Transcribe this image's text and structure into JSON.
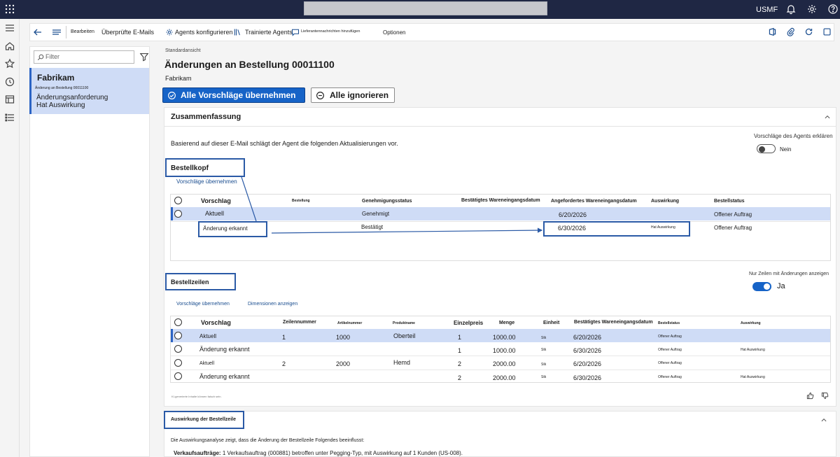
{
  "company": "USMF",
  "action_bar": {
    "edit": "Bearbeiten",
    "checked_emails": "Überprüfte E-Mails",
    "configure_agents": "Agents konfigurieren",
    "trained_agents": "Trainierte Agents",
    "add_vendor_messages": "Lieferantennachrichten hinzufügen",
    "options": "Optionen"
  },
  "list": {
    "filter_placeholder": "Filter",
    "item": {
      "title": "Fabrikam",
      "subtitle": "Änderung an Bestellung 00011100",
      "line1": "Änderungsanforderung",
      "line2": "Hat Auswirkung"
    }
  },
  "page": {
    "view": "Standardansicht",
    "title": "Änderungen an Bestellung 00011100",
    "vendor": "Fabrikam",
    "accept_all": "Alle Vorschläge übernehmen",
    "ignore_all": "Alle ignorieren"
  },
  "summary": {
    "title": "Zusammenfassung",
    "explain_label": "Vorschläge des Agents erklären",
    "explain_value": "Nein",
    "explain_on": false,
    "intro": "Basierend auf dieser E-Mail schlägt der Agent die folgenden Aktualisierungen vor."
  },
  "header_section": {
    "title": "Bestellkopf",
    "accept": "Vorschläge übernehmen",
    "columns": [
      "Vorschlag",
      "Bestellung",
      "Genehmigungsstatus",
      "Bestätigtes Wareneingangsdatum",
      "Angefordertes Wareneingangsdatum",
      "Auswirkung",
      "Bestellstatus"
    ],
    "rows": [
      {
        "proposal": "Aktuell",
        "order": "",
        "approval": "Genehmigt",
        "confirmed": "",
        "requested": "6/20/2026",
        "impact": "",
        "status": "Offener Auftrag"
      },
      {
        "proposal": "Änderung erkannt",
        "order": "",
        "approval": "Bestätigt",
        "confirmed": "",
        "requested": "6/30/2026",
        "impact": "Hat Auswirkung",
        "status": "Offener Auftrag"
      }
    ]
  },
  "lines_section": {
    "title": "Bestellzeilen",
    "only_changes_label": "Nur Zeilen mit Änderungen anzeigen",
    "only_changes_value": "Ja",
    "only_changes_on": true,
    "accept": "Vorschläge übernehmen",
    "dimensions": "Dimensionen anzeigen",
    "columns": [
      "Vorschlag",
      "Zeilennummer",
      "Artikelnummer",
      "Produktname",
      "Einzelpreis",
      "Menge",
      "Einheit",
      "Bestätigtes Wareneingangsdatum",
      "Bestellstatus",
      "Auswirkung"
    ],
    "rows": [
      {
        "proposal": "Aktuell",
        "line": "1",
        "item": "1000",
        "product": "Oberteil",
        "price": "1",
        "qty": "1000.00",
        "unit": "Stk",
        "date": "6/20/2026",
        "status": "Offener Auftrag",
        "impact": ""
      },
      {
        "proposal": "Änderung erkannt",
        "line": "",
        "item": "",
        "product": "",
        "price": "1",
        "qty": "1000.00",
        "unit": "Stk",
        "date": "6/30/2026",
        "status": "Offener Auftrag",
        "impact": "Hat Auswirkung"
      },
      {
        "proposal": "Aktuell",
        "line": "2",
        "item": "2000",
        "product": "Hemd",
        "price": "2",
        "qty": "2000.00",
        "unit": "Stk",
        "date": "6/20/2026",
        "status": "Offener Auftrag",
        "impact": ""
      },
      {
        "proposal": "Änderung erkannt",
        "line": "",
        "item": "",
        "product": "",
        "price": "2",
        "qty": "2000.00",
        "unit": "Stk",
        "date": "6/30/2026",
        "status": "Offener Auftrag",
        "impact": "Hat Auswirkung"
      }
    ],
    "footnote": "KI-generierte Inhalte können falsch sein."
  },
  "impact_section": {
    "title": "Auswirkung der Bestellzeile",
    "intro": "Die Auswirkungsanalyse zeigt, dass die Änderung der Bestellzeile Folgendes beeinflusst:",
    "sales_label": "Verkaufsaufträge:",
    "sales_text": "1 Verkaufsauftrag (000881) betroffen unter Pegging-Typ, mit Auswirkung auf 1 Kunden (US-008)."
  }
}
